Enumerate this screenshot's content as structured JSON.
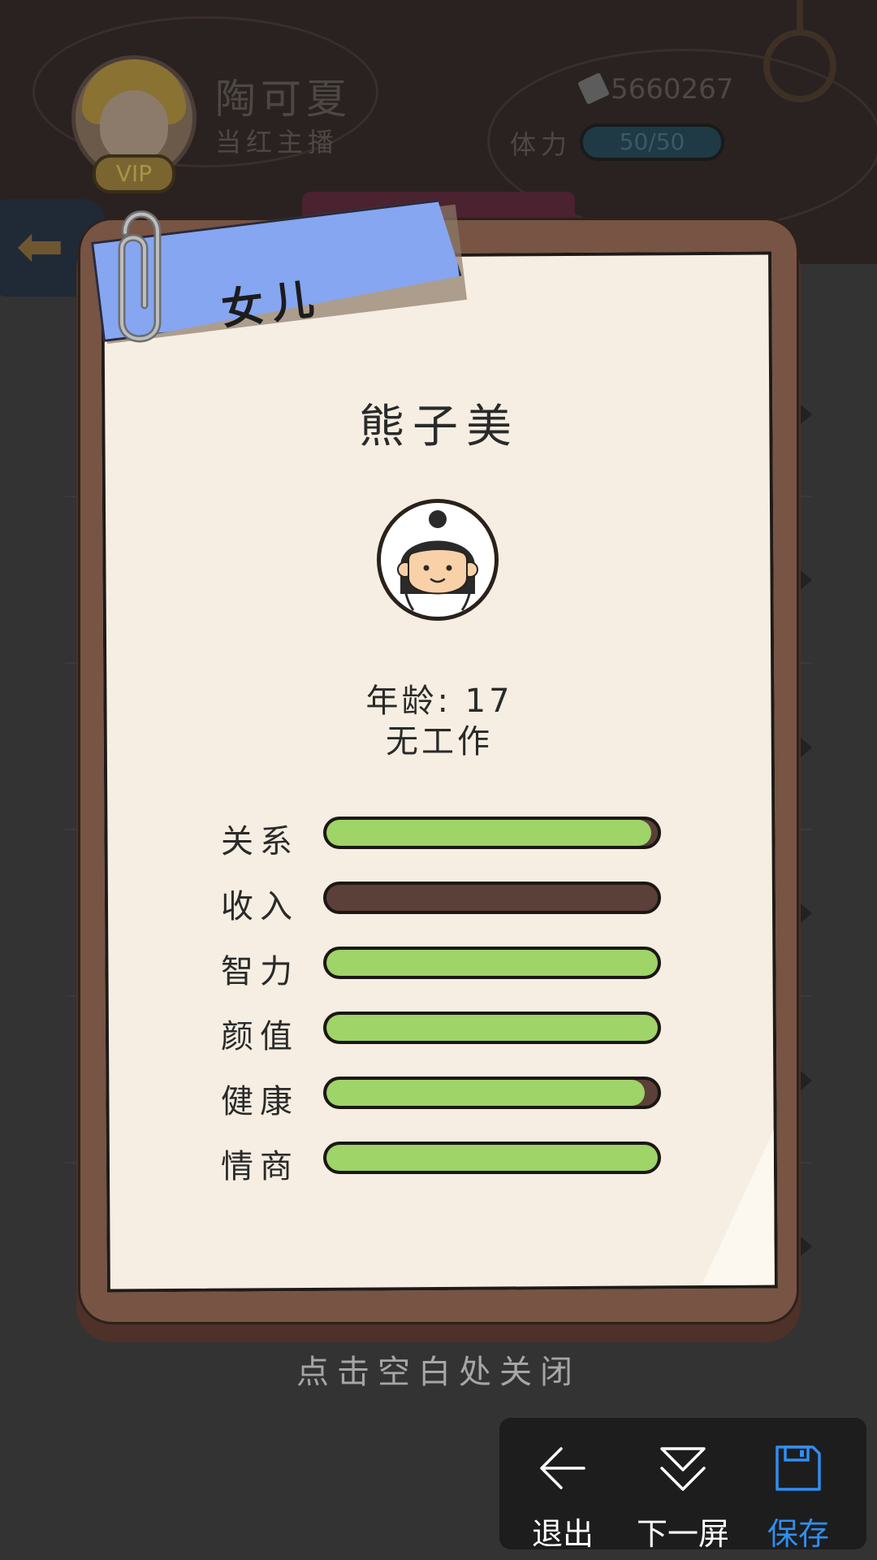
{
  "background": {
    "player_name": "陶可夏",
    "player_title": "当红主播",
    "vip_badge": "VIP",
    "money": "5660267",
    "stamina_label": "体力",
    "stamina_value": "50/50"
  },
  "modal": {
    "category_ribbon": "女儿",
    "child_name": "熊子美",
    "age_line": "年龄: 17",
    "job_line": "无工作",
    "stats": [
      {
        "label": "关系",
        "fill": 0.98
      },
      {
        "label": "收入",
        "fill": 0.0
      },
      {
        "label": "智力",
        "fill": 1.0
      },
      {
        "label": "颜值",
        "fill": 1.0
      },
      {
        "label": "健康",
        "fill": 0.96
      },
      {
        "label": "情商",
        "fill": 1.0
      }
    ],
    "close_hint": "点击空白处关闭"
  },
  "toolbar": {
    "exit_label": "退出",
    "next_label": "下一屏",
    "save_label": "保存",
    "accent_color": "#2f8ef0"
  },
  "colors": {
    "ribbon": "#86a6f2",
    "bar_fill": "#9ed468",
    "bar_empty": "#5a4038",
    "card": "#775443",
    "paper": "#f6eee2"
  }
}
